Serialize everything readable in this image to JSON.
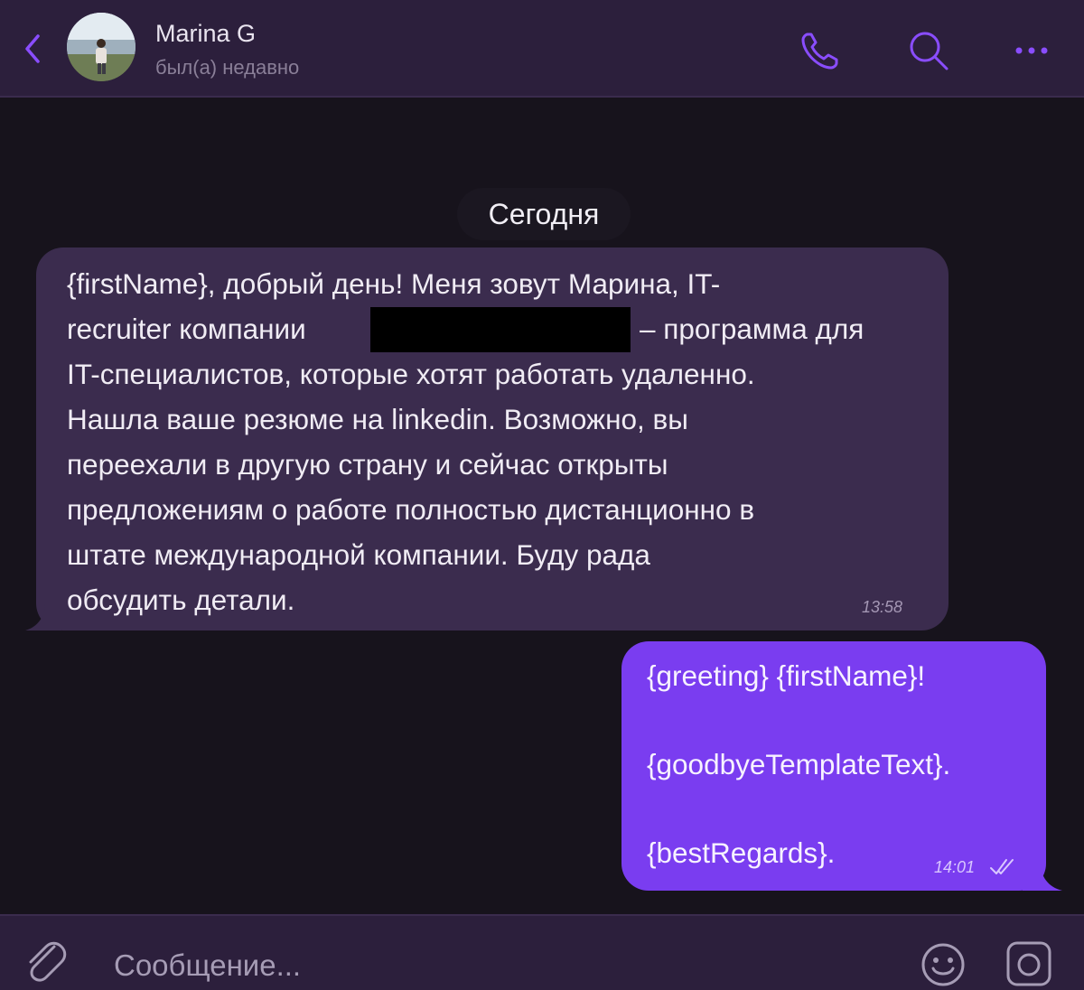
{
  "header": {
    "contact_name": "Marina G",
    "status": "был(а) недавно",
    "icons": [
      "back-chevron-icon",
      "phone-icon",
      "search-icon",
      "more-icon"
    ]
  },
  "chat": {
    "date_divider": "Сегодня",
    "incoming": {
      "lines": [
        "{firstName}, добрый день! Меня зовут Марина, IT-",
        "recruiter компании",
        "– программа для",
        "IT-специалистов, которые хотят работать удаленно.",
        "Нашла ваше резюме на linkedin. Возможно, вы",
        "переехали в другую страну и сейчас открыты",
        "предложениям о работе полностью дистанционно в",
        "штате международной компании. Буду рада",
        "обсудить детали."
      ],
      "time": "13:58"
    },
    "outgoing": {
      "lines": [
        "{greeting} {firstName}!",
        "{goodbyeTemplateText}.",
        "{bestRegards}."
      ],
      "time": "14:01",
      "status": "read"
    }
  },
  "composer": {
    "placeholder": "Сообщение...",
    "icons": [
      "attach-icon",
      "emoji-icon",
      "camera-icon"
    ]
  },
  "colors": {
    "background": "#17131c",
    "header": "#2c1f3c",
    "incoming_bubble": "#3b2c4e",
    "outgoing_bubble": "#7a3df0",
    "accent": "#8a4dff"
  }
}
